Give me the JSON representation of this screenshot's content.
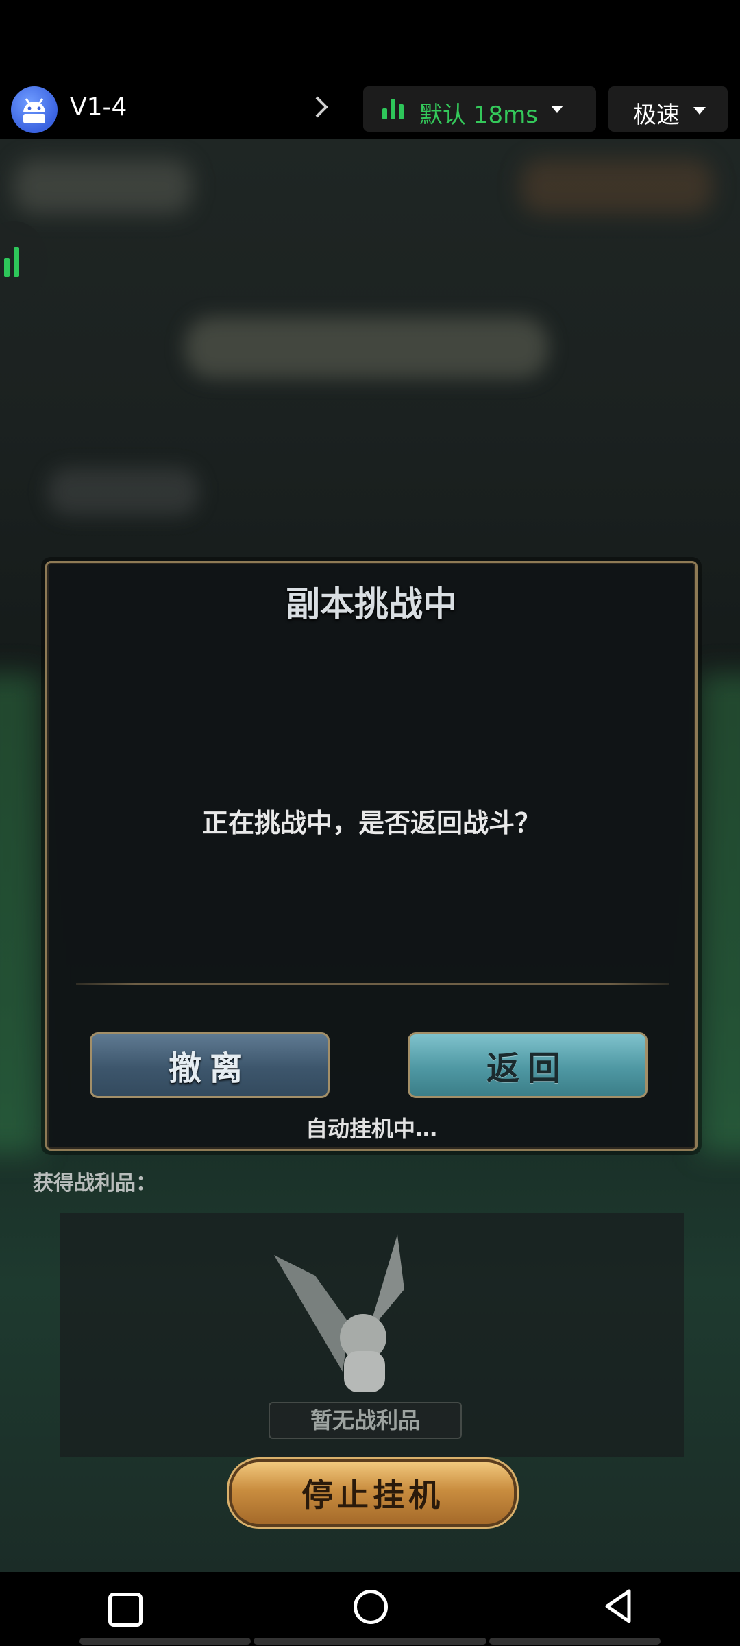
{
  "app": {
    "title": "V1-4",
    "network_label": "默认 18ms",
    "mode_label": "极速",
    "network_color": "#34c85a"
  },
  "dialog": {
    "title": "副本挑战中",
    "message": "正在挑战中，是否返回战斗？",
    "leave_label": "撤离",
    "return_label": "返回",
    "auto_status": "自动挂机中…"
  },
  "loot": {
    "label": "获得战利品：",
    "empty_text": "暂无战利品"
  },
  "stop_button": {
    "label": "停止挂机"
  },
  "icons": {
    "app_icon": "android-icon",
    "chevron": "chevron-right-icon",
    "signal": "signal-bars-icon",
    "dropdown": "caret-down-icon",
    "nav_recent": "square-icon",
    "nav_home": "circle-icon",
    "nav_back": "triangle-back-icon"
  }
}
